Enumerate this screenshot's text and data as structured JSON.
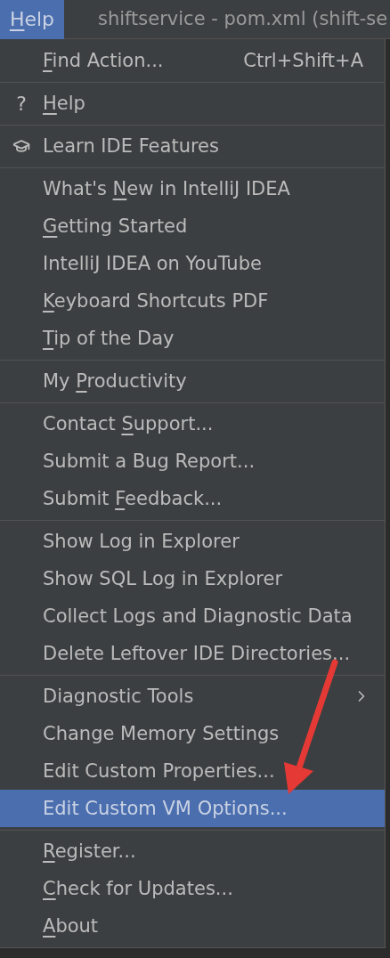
{
  "menubar": {
    "menu": {
      "key": "H",
      "post": "elp",
      "selected": true
    },
    "window_title": "shiftservice - pom.xml (shift-se"
  },
  "sections": [
    [
      {
        "key": "F",
        "post": "ind Action...",
        "shortcut": "Ctrl+Shift+A",
        "selected": false
      }
    ],
    [
      {
        "kind": "help",
        "key": "H",
        "post": "elp",
        "icon_text": "?",
        "selected": false
      }
    ],
    [
      {
        "kind": "learn",
        "label": "Learn IDE Features",
        "selected": false
      }
    ],
    [
      {
        "pre": "What's ",
        "key": "N",
        "post": "ew in IntelliJ IDEA",
        "selected": false
      },
      {
        "key": "G",
        "post": "etting Started",
        "selected": false
      },
      {
        "label": "IntelliJ IDEA on YouTube",
        "selected": false
      },
      {
        "key": "K",
        "post": "eyboard Shortcuts PDF",
        "selected": false
      },
      {
        "key": "T",
        "post": "ip of the Day",
        "selected": false
      }
    ],
    [
      {
        "pre": "My ",
        "key": "P",
        "post": "roductivity",
        "selected": false
      }
    ],
    [
      {
        "pre": "Contact ",
        "key": "S",
        "post": "upport...",
        "selected": false
      },
      {
        "label": "Submit a Bug Report...",
        "selected": false
      },
      {
        "pre": "Submit ",
        "key": "F",
        "post": "eedback...",
        "selected": false
      }
    ],
    [
      {
        "label": "Show Log in Explorer",
        "selected": false
      },
      {
        "label": "Show SQL Log in Explorer",
        "selected": false
      },
      {
        "label": "Collect Logs and Diagnostic Data",
        "selected": false
      },
      {
        "label": "Delete Leftover IDE Directories...",
        "selected": false
      }
    ],
    [
      {
        "kind": "submenu",
        "label": "Diagnostic Tools",
        "selected": false
      },
      {
        "label": "Change Memory Settings",
        "selected": false
      },
      {
        "label": "Edit Custom Properties...",
        "selected": false
      },
      {
        "label": "Edit Custom VM Options...",
        "selected": true
      }
    ],
    [
      {
        "key": "R",
        "post": "egister...",
        "selected": false
      },
      {
        "key": "C",
        "post": "heck for Updates...",
        "selected": false
      },
      {
        "key": "A",
        "post": "bout",
        "selected": false
      }
    ]
  ]
}
